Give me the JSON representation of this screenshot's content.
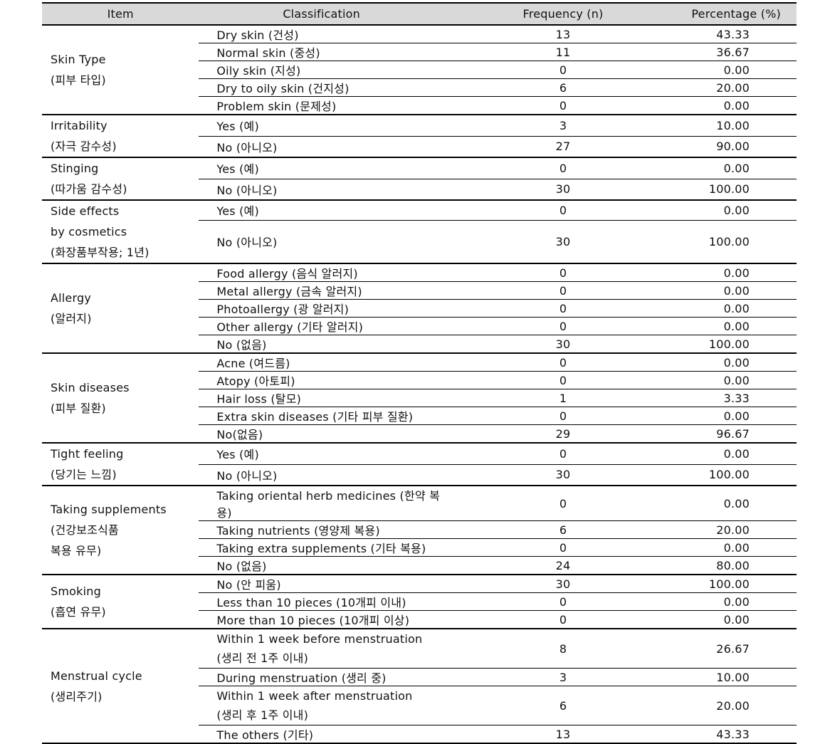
{
  "table": {
    "headers": {
      "item": "Item",
      "classification": "Classification",
      "frequency": "Frequency (n)",
      "percentage": "Percentage (%)"
    },
    "groups": [
      {
        "item_lines": [
          "Skin Type",
          "(피부 타입)"
        ],
        "rows": [
          {
            "classification": "Dry skin (건성)",
            "frequency": "13",
            "percentage": "43.33"
          },
          {
            "classification": "Normal skin (중성)",
            "frequency": "11",
            "percentage": "36.67"
          },
          {
            "classification": "Oily skin (지성)",
            "frequency": "0",
            "percentage": "0.00"
          },
          {
            "classification": "Dry to oily skin (건지성)",
            "frequency": "6",
            "percentage": "20.00"
          },
          {
            "classification": "Problem skin (문제성)",
            "frequency": "0",
            "percentage": "0.00"
          }
        ]
      },
      {
        "item_lines": [
          "Irritability",
          "(자극 감수성)"
        ],
        "rows": [
          {
            "classification": "Yes (예)",
            "frequency": "3",
            "percentage": "10.00"
          },
          {
            "classification": "No (아니오)",
            "frequency": "27",
            "percentage": "90.00"
          }
        ]
      },
      {
        "item_lines": [
          "Stinging",
          "(따가움 감수성)"
        ],
        "rows": [
          {
            "classification": "Yes (예)",
            "frequency": "0",
            "percentage": "0.00"
          },
          {
            "classification": "No (아니오)",
            "frequency": "30",
            "percentage": "100.00"
          }
        ]
      },
      {
        "item_lines": [
          "Side effects",
          "by cosmetics",
          "(화장품부작용; 1년)"
        ],
        "rows": [
          {
            "classification": "Yes (예)",
            "frequency": "0",
            "percentage": "0.00"
          },
          {
            "classification": "No (아니오)",
            "frequency": "30",
            "percentage": "100.00"
          }
        ]
      },
      {
        "item_lines": [
          "Allergy",
          "(알러지)"
        ],
        "rows": [
          {
            "classification": "Food allergy (음식 알러지)",
            "frequency": "0",
            "percentage": "0.00"
          },
          {
            "classification": "Metal allergy (금속 알러지)",
            "frequency": "0",
            "percentage": "0.00"
          },
          {
            "classification": "Photoallergy (광 알러지)",
            "frequency": "0",
            "percentage": "0.00"
          },
          {
            "classification": "Other allergy (기타 알러지)",
            "frequency": "0",
            "percentage": "0.00"
          },
          {
            "classification": "No (없음)",
            "frequency": "30",
            "percentage": "100.00"
          }
        ]
      },
      {
        "item_lines": [
          "Skin diseases",
          "(피부 질환)"
        ],
        "rows": [
          {
            "classification": "Acne (여드름)",
            "frequency": "0",
            "percentage": "0.00"
          },
          {
            "classification": "Atopy (아토피)",
            "frequency": "0",
            "percentage": "0.00"
          },
          {
            "classification": "Hair loss (탈모)",
            "frequency": "1",
            "percentage": "3.33"
          },
          {
            "classification": "Extra skin diseases (기타 피부 질환)",
            "frequency": "0",
            "percentage": "0.00"
          },
          {
            "classification": "No(없음)",
            "frequency": "29",
            "percentage": "96.67"
          }
        ]
      },
      {
        "item_lines": [
          "Tight feeling",
          "(당기는 느낌)"
        ],
        "rows": [
          {
            "classification": "Yes (예)",
            "frequency": "0",
            "percentage": "0.00"
          },
          {
            "classification": "No (아니오)",
            "frequency": "30",
            "percentage": "100.00"
          }
        ]
      },
      {
        "item_lines": [
          "Taking supplements",
          "(건강보조식품",
          "복용 유무)"
        ],
        "rows": [
          {
            "classification": "Taking oriental herb medicines (한약 복용)",
            "frequency": "0",
            "percentage": "0.00"
          },
          {
            "classification": "Taking nutrients (영양제 복용)",
            "frequency": "6",
            "percentage": "20.00"
          },
          {
            "classification": "Taking extra supplements (기타 복용)",
            "frequency": "0",
            "percentage": "0.00"
          },
          {
            "classification": "No (없음)",
            "frequency": "24",
            "percentage": "80.00"
          }
        ]
      },
      {
        "item_lines": [
          "Smoking",
          "(흡연 유무)"
        ],
        "rows": [
          {
            "classification": "No (안 피움)",
            "frequency": "30",
            "percentage": "100.00"
          },
          {
            "classification": "Less than 10 pieces (10개피 이내)",
            "frequency": "0",
            "percentage": "0.00"
          },
          {
            "classification": "More than 10 pieces (10개피 이상)",
            "frequency": "0",
            "percentage": "0.00"
          }
        ]
      },
      {
        "item_lines": [
          "Menstrual cycle",
          "(생리주기)"
        ],
        "rows": [
          {
            "classification_lines": [
              "Within 1 week before menstruation",
              "(생리 전 1주 이내)"
            ],
            "frequency": "8",
            "percentage": "26.67"
          },
          {
            "classification": "During menstruation (생리 중)",
            "frequency": "3",
            "percentage": "10.00"
          },
          {
            "classification_lines": [
              "Within 1 week after menstruation",
              "(생리 후 1주 이내)"
            ],
            "frequency": "6",
            "percentage": "20.00"
          },
          {
            "classification": "The others (기타)",
            "frequency": "13",
            "percentage": "43.33"
          }
        ]
      }
    ]
  }
}
